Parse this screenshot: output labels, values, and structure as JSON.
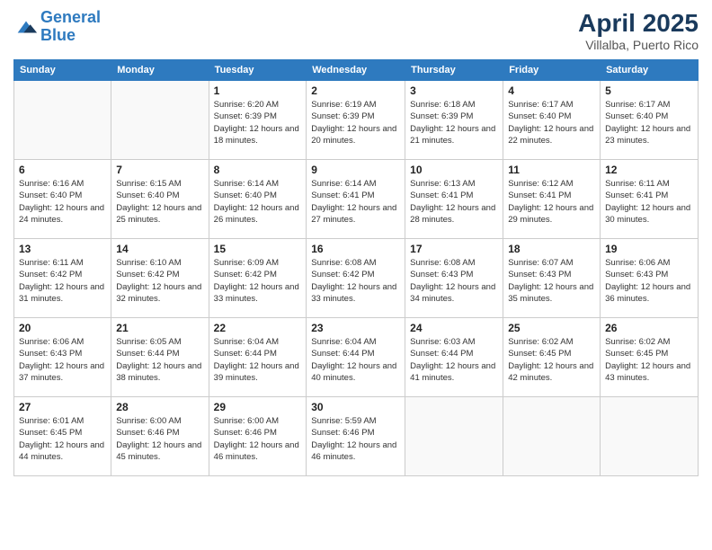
{
  "header": {
    "logo_line1": "General",
    "logo_line2": "Blue",
    "month_title": "April 2025",
    "location": "Villalba, Puerto Rico"
  },
  "days_of_week": [
    "Sunday",
    "Monday",
    "Tuesday",
    "Wednesday",
    "Thursday",
    "Friday",
    "Saturday"
  ],
  "weeks": [
    [
      {
        "day": "",
        "info": ""
      },
      {
        "day": "",
        "info": ""
      },
      {
        "day": "1",
        "info": "Sunrise: 6:20 AM\nSunset: 6:39 PM\nDaylight: 12 hours and 18 minutes."
      },
      {
        "day": "2",
        "info": "Sunrise: 6:19 AM\nSunset: 6:39 PM\nDaylight: 12 hours and 20 minutes."
      },
      {
        "day": "3",
        "info": "Sunrise: 6:18 AM\nSunset: 6:39 PM\nDaylight: 12 hours and 21 minutes."
      },
      {
        "day": "4",
        "info": "Sunrise: 6:17 AM\nSunset: 6:40 PM\nDaylight: 12 hours and 22 minutes."
      },
      {
        "day": "5",
        "info": "Sunrise: 6:17 AM\nSunset: 6:40 PM\nDaylight: 12 hours and 23 minutes."
      }
    ],
    [
      {
        "day": "6",
        "info": "Sunrise: 6:16 AM\nSunset: 6:40 PM\nDaylight: 12 hours and 24 minutes."
      },
      {
        "day": "7",
        "info": "Sunrise: 6:15 AM\nSunset: 6:40 PM\nDaylight: 12 hours and 25 minutes."
      },
      {
        "day": "8",
        "info": "Sunrise: 6:14 AM\nSunset: 6:40 PM\nDaylight: 12 hours and 26 minutes."
      },
      {
        "day": "9",
        "info": "Sunrise: 6:14 AM\nSunset: 6:41 PM\nDaylight: 12 hours and 27 minutes."
      },
      {
        "day": "10",
        "info": "Sunrise: 6:13 AM\nSunset: 6:41 PM\nDaylight: 12 hours and 28 minutes."
      },
      {
        "day": "11",
        "info": "Sunrise: 6:12 AM\nSunset: 6:41 PM\nDaylight: 12 hours and 29 minutes."
      },
      {
        "day": "12",
        "info": "Sunrise: 6:11 AM\nSunset: 6:41 PM\nDaylight: 12 hours and 30 minutes."
      }
    ],
    [
      {
        "day": "13",
        "info": "Sunrise: 6:11 AM\nSunset: 6:42 PM\nDaylight: 12 hours and 31 minutes."
      },
      {
        "day": "14",
        "info": "Sunrise: 6:10 AM\nSunset: 6:42 PM\nDaylight: 12 hours and 32 minutes."
      },
      {
        "day": "15",
        "info": "Sunrise: 6:09 AM\nSunset: 6:42 PM\nDaylight: 12 hours and 33 minutes."
      },
      {
        "day": "16",
        "info": "Sunrise: 6:08 AM\nSunset: 6:42 PM\nDaylight: 12 hours and 33 minutes."
      },
      {
        "day": "17",
        "info": "Sunrise: 6:08 AM\nSunset: 6:43 PM\nDaylight: 12 hours and 34 minutes."
      },
      {
        "day": "18",
        "info": "Sunrise: 6:07 AM\nSunset: 6:43 PM\nDaylight: 12 hours and 35 minutes."
      },
      {
        "day": "19",
        "info": "Sunrise: 6:06 AM\nSunset: 6:43 PM\nDaylight: 12 hours and 36 minutes."
      }
    ],
    [
      {
        "day": "20",
        "info": "Sunrise: 6:06 AM\nSunset: 6:43 PM\nDaylight: 12 hours and 37 minutes."
      },
      {
        "day": "21",
        "info": "Sunrise: 6:05 AM\nSunset: 6:44 PM\nDaylight: 12 hours and 38 minutes."
      },
      {
        "day": "22",
        "info": "Sunrise: 6:04 AM\nSunset: 6:44 PM\nDaylight: 12 hours and 39 minutes."
      },
      {
        "day": "23",
        "info": "Sunrise: 6:04 AM\nSunset: 6:44 PM\nDaylight: 12 hours and 40 minutes."
      },
      {
        "day": "24",
        "info": "Sunrise: 6:03 AM\nSunset: 6:44 PM\nDaylight: 12 hours and 41 minutes."
      },
      {
        "day": "25",
        "info": "Sunrise: 6:02 AM\nSunset: 6:45 PM\nDaylight: 12 hours and 42 minutes."
      },
      {
        "day": "26",
        "info": "Sunrise: 6:02 AM\nSunset: 6:45 PM\nDaylight: 12 hours and 43 minutes."
      }
    ],
    [
      {
        "day": "27",
        "info": "Sunrise: 6:01 AM\nSunset: 6:45 PM\nDaylight: 12 hours and 44 minutes."
      },
      {
        "day": "28",
        "info": "Sunrise: 6:00 AM\nSunset: 6:46 PM\nDaylight: 12 hours and 45 minutes."
      },
      {
        "day": "29",
        "info": "Sunrise: 6:00 AM\nSunset: 6:46 PM\nDaylight: 12 hours and 46 minutes."
      },
      {
        "day": "30",
        "info": "Sunrise: 5:59 AM\nSunset: 6:46 PM\nDaylight: 12 hours and 46 minutes."
      },
      {
        "day": "",
        "info": ""
      },
      {
        "day": "",
        "info": ""
      },
      {
        "day": "",
        "info": ""
      }
    ]
  ]
}
